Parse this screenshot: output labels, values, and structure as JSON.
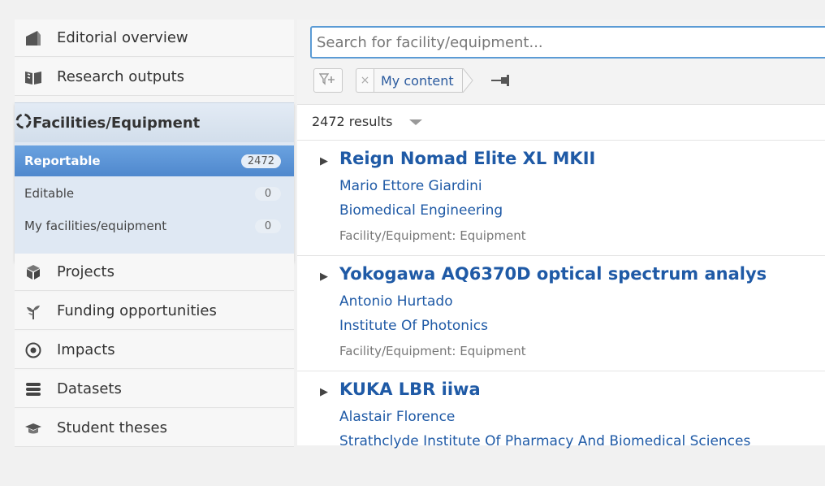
{
  "sidebar": {
    "items_top": [
      {
        "label": "Editorial overview",
        "icon": "editorial-icon"
      },
      {
        "label": "Research outputs",
        "icon": "book-icon"
      }
    ],
    "section": {
      "label": "Facilities/Equipment",
      "icon": "facilities-icon",
      "subitems": [
        {
          "label": "Reportable",
          "count": "2472",
          "active": true
        },
        {
          "label": "Editable",
          "count": "0",
          "active": false
        },
        {
          "label": "My facilities/equipment",
          "count": "0",
          "active": false
        }
      ]
    },
    "items_bottom": [
      {
        "label": "Projects",
        "icon": "cube-icon"
      },
      {
        "label": "Funding opportunities",
        "icon": "sprout-icon"
      },
      {
        "label": "Impacts",
        "icon": "target-icon"
      },
      {
        "label": "Datasets",
        "icon": "database-icon"
      },
      {
        "label": "Student theses",
        "icon": "graduation-cap-icon"
      }
    ]
  },
  "search": {
    "placeholder": "Search for facility/equipment...",
    "value": ""
  },
  "filters": {
    "chip_label": "My content"
  },
  "results": {
    "count_text": "2472 results",
    "items": [
      {
        "title": "Reign Nomad Elite XL MKII",
        "person": "Mario Ettore Giardini",
        "organisation": "Biomedical Engineering",
        "type": "Facility/Equipment: Equipment"
      },
      {
        "title": "Yokogawa AQ6370D optical spectrum analys",
        "person": "Antonio Hurtado",
        "organisation": "Institute Of Photonics",
        "type": "Facility/Equipment: Equipment"
      },
      {
        "title": "KUKA LBR iiwa",
        "person": "Alastair Florence",
        "organisation": "Strathclyde Institute Of Pharmacy And Biomedical Sciences",
        "type": ""
      }
    ]
  },
  "colors": {
    "accent": "#5b9bd5",
    "link": "#1f5aa6",
    "active_item": "#5d97d9"
  }
}
